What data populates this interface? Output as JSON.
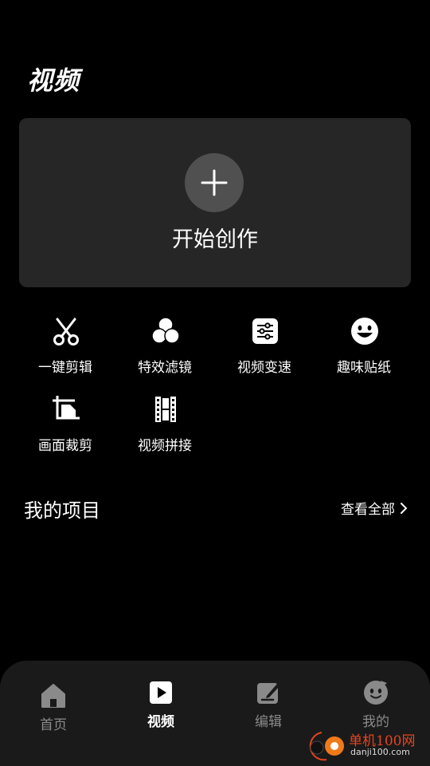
{
  "header": {
    "title": "视频"
  },
  "create": {
    "label": "开始创作",
    "icon": "plus-icon"
  },
  "tools": [
    {
      "label": "一键剪辑",
      "icon": "scissors-icon"
    },
    {
      "label": "特效滤镜",
      "icon": "filter-circles-icon"
    },
    {
      "label": "视频变速",
      "icon": "speed-sliders-icon"
    },
    {
      "label": "趣味贴纸",
      "icon": "smiley-sticker-icon"
    },
    {
      "label": "画面裁剪",
      "icon": "crop-document-icon"
    },
    {
      "label": "视频拼接",
      "icon": "film-strip-icon"
    }
  ],
  "projects": {
    "title": "我的项目",
    "view_all": "查看全部"
  },
  "tabbar": {
    "active": "视频",
    "items": [
      {
        "label": "首页",
        "icon": "home-icon"
      },
      {
        "label": "视频",
        "icon": "play-icon"
      },
      {
        "label": "编辑",
        "icon": "edit-icon"
      },
      {
        "label": "我的",
        "icon": "profile-face-icon"
      }
    ]
  },
  "watermark": {
    "name": "单机100网",
    "url": "danji100.com"
  },
  "colors": {
    "background": "#000000",
    "card": "#262626",
    "tabbar": "#1a1a1a",
    "inactive_tab": "#8a8a8a",
    "watermark_brand": "#e7441f"
  }
}
